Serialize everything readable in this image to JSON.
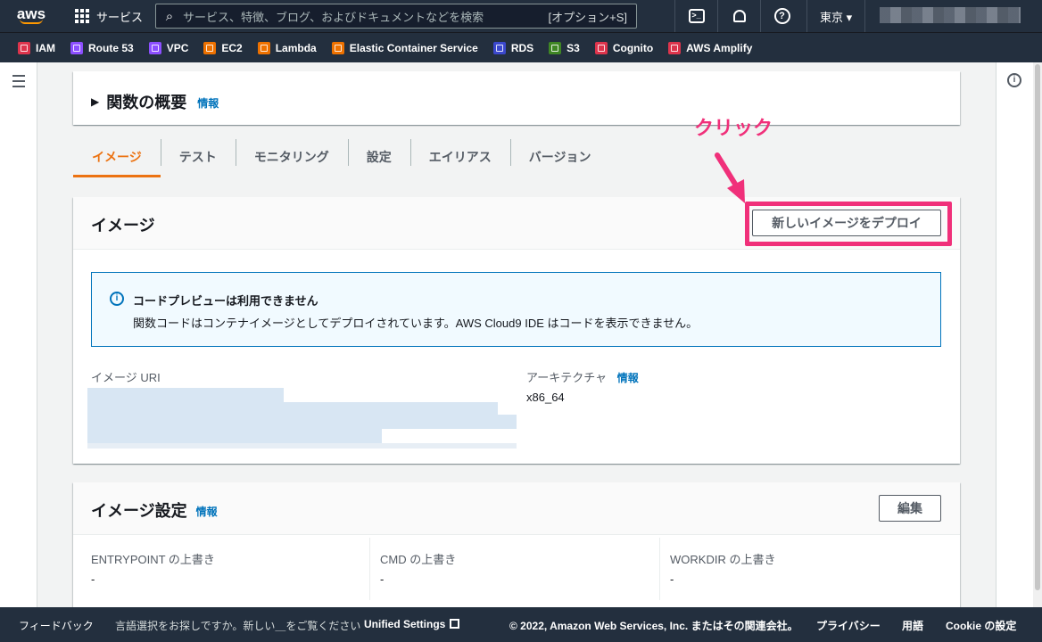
{
  "topnav": {
    "logo": "aws",
    "services_label": "サービス",
    "search_placeholder": "サービス、特徴、ブログ、およびドキュメントなどを検索",
    "search_shortcut": "[オプション+S]",
    "region": "東京 ▾",
    "cloudshell_icon": "terminal-icon",
    "bell_icon": "bell-icon",
    "help_icon": "help-icon"
  },
  "favorites": [
    {
      "label": "IAM",
      "color": "#dd344c"
    },
    {
      "label": "Route 53",
      "color": "#8c4fff"
    },
    {
      "label": "VPC",
      "color": "#8c4fff"
    },
    {
      "label": "EC2",
      "color": "#ed7100"
    },
    {
      "label": "Lambda",
      "color": "#ed7100"
    },
    {
      "label": "Elastic Container Service",
      "color": "#ed7100"
    },
    {
      "label": "RDS",
      "color": "#3b48cc"
    },
    {
      "label": "S3",
      "color": "#3f8624"
    },
    {
      "label": "Cognito",
      "color": "#dd344c"
    },
    {
      "label": "AWS Amplify",
      "color": "#dd344c"
    }
  ],
  "overview": {
    "title": "関数の概要",
    "info": "情報"
  },
  "tabs": [
    "イメージ",
    "テスト",
    "モニタリング",
    "設定",
    "エイリアス",
    "バージョン"
  ],
  "image_card": {
    "title": "イメージ",
    "deploy_button": "新しいイメージをデプロイ",
    "alert_title": "コードプレビューは利用できません",
    "alert_message": "関数コードはコンテナイメージとしてデプロイされています。AWS Cloud9 IDE はコードを表示できません。",
    "uri_label": "イメージ URI",
    "arch_label": "アーキテクチャ",
    "arch_info": "情報",
    "arch_value": "x86_64"
  },
  "annotation": {
    "callout": "クリック",
    "color": "#f0307a"
  },
  "settings_card": {
    "title": "イメージ設定",
    "info": "情報",
    "edit_button": "編集",
    "entrypoint_label": "ENTRYPOINT の上書き",
    "entrypoint_value": "-",
    "cmd_label": "CMD の上書き",
    "cmd_value": "-",
    "workdir_label": "WORKDIR の上書き",
    "workdir_value": "-"
  },
  "footer": {
    "feedback": "フィードバック",
    "language_prompt": "言語選択をお探しですか。新しい＿をご覧ください",
    "unified_settings": "Unified Settings",
    "copyright": "© 2022, Amazon Web Services, Inc. またはその関連会社。",
    "privacy": "プライバシー",
    "terms": "用語",
    "cookie": "Cookie の設定"
  },
  "colors": {
    "nav_bg": "#232f3e",
    "accent": "#ec7211",
    "link": "#0073bb"
  }
}
